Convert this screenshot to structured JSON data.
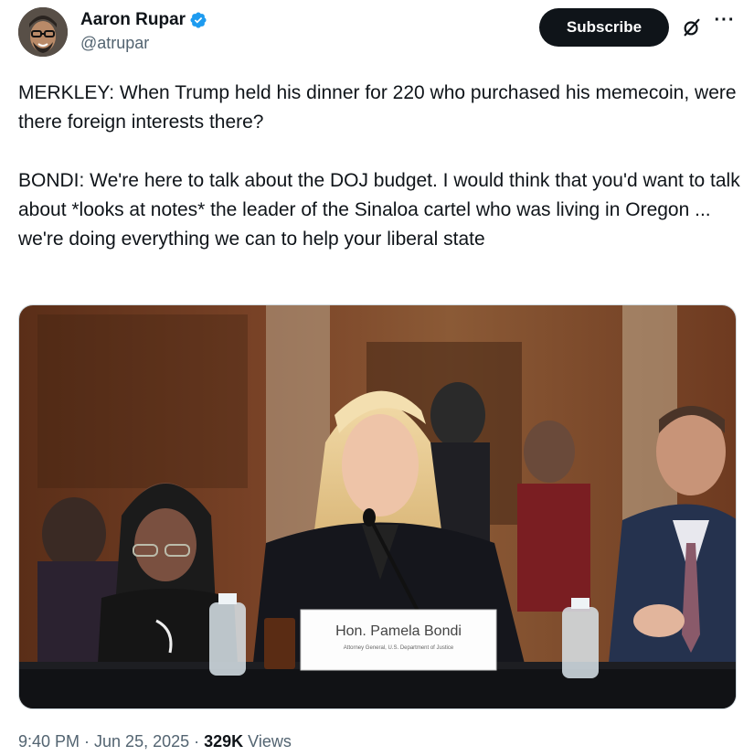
{
  "author": {
    "display_name": "Aaron Rupar",
    "handle": "@atrupar",
    "verified_icon": "verified-badge-icon",
    "verified_color": "#1d9bf0"
  },
  "actions": {
    "subscribe_label": "Subscribe",
    "grok_icon": "grok-icon",
    "more_icon": "more-options-icon",
    "more_glyph": "···"
  },
  "tweet": {
    "paragraph_1": "MERKLEY: When Trump held his dinner for 220 who purchased his memecoin, were there foreign interests there?",
    "paragraph_2": "BONDI: We're here to talk about the DOJ budget. I would think that you'd want to talk about *looks at notes* the leader of the Sinaloa cartel who was living in Oregon ... we're doing everything we can to help your liberal state"
  },
  "media": {
    "nameplate_title": "Hon. Pamela Bondi",
    "nameplate_subtitle": "Attorney General, U.S. Department of Justice"
  },
  "meta": {
    "time_date": "9:40 PM · Jun 25, 2025 · ",
    "views_count": "329K",
    "views_label": " Views"
  }
}
